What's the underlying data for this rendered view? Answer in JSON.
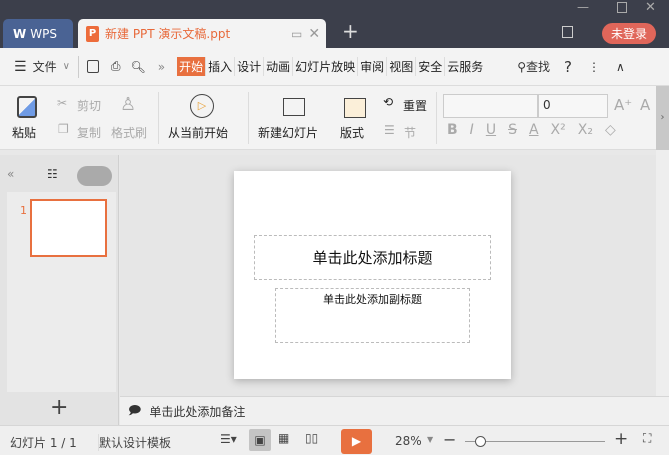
{
  "titlebar": {
    "app_tab": "WPS",
    "doc_tab": "新建 PPT 演示文稿.ppt",
    "new_tab": "+",
    "login": "未登录"
  },
  "menu": {
    "file": "文件",
    "tabs": [
      "开始",
      "插入",
      "设计",
      "动画",
      "幻灯片放映",
      "审阅",
      "视图",
      "安全",
      "云服务"
    ],
    "search": "查找",
    "help": "?"
  },
  "ribbon": {
    "paste": "粘贴",
    "cut": "剪切",
    "copy": "复制",
    "format_painter": "格式刷",
    "play_from_current": "从当前开始",
    "new_slide": "新建幻灯片",
    "layout": "版式",
    "reset": "重置",
    "section": "节",
    "font_name": "",
    "font_size": "0"
  },
  "slides": {
    "number": "1"
  },
  "slide": {
    "title_placeholder": "单击此处添加标题",
    "subtitle_placeholder": "单击此处添加副标题"
  },
  "notes": {
    "placeholder": "单击此处添加备注"
  },
  "status": {
    "slide_count": "幻灯片 1 / 1",
    "template": "默认设计模板",
    "zoom": "28%"
  },
  "colors": {
    "accent": "#e8703f",
    "titlebar": "#3c3f4b",
    "wps_tab": "#4a6394",
    "login": "#e0665a"
  }
}
